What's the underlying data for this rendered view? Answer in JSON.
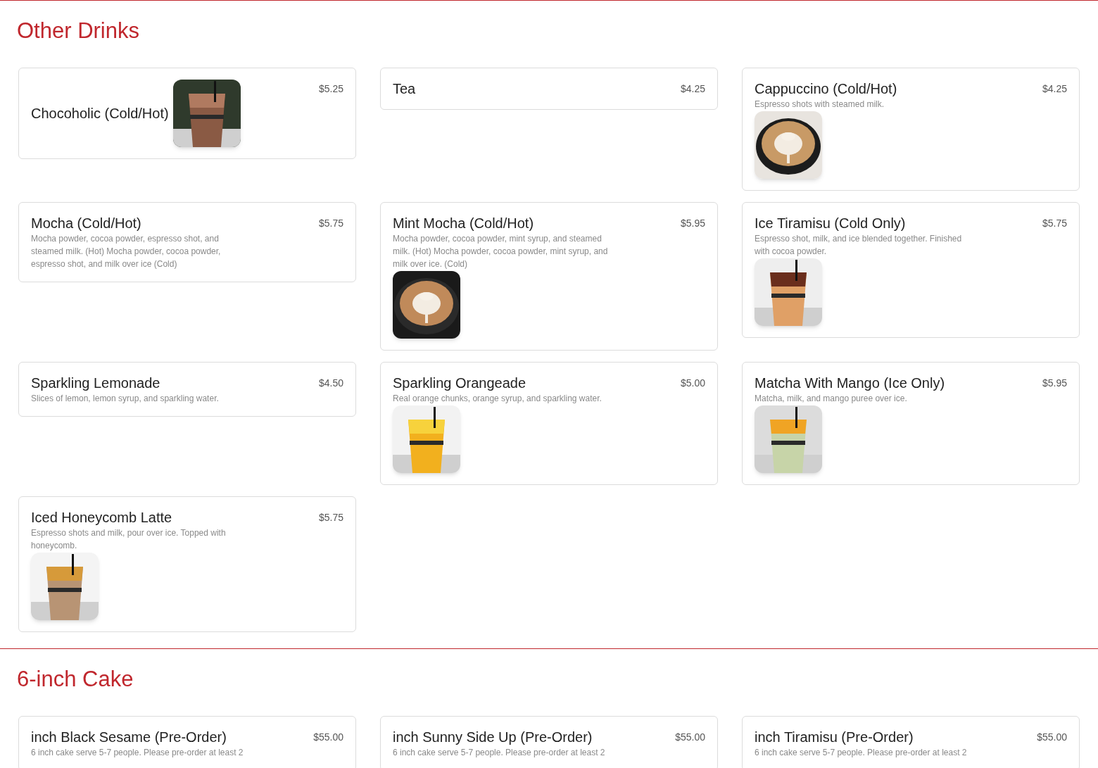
{
  "sections": [
    {
      "title": "Other Drinks",
      "items": [
        {
          "name": "Chocoholic (Cold/Hot)",
          "price": "$5.25",
          "kind": "inline"
        },
        {
          "name": "Tea",
          "price": "$4.25"
        },
        {
          "name": "Cappuccino (Cold/Hot)",
          "price": "$4.25",
          "description": "Espresso shots with steamed milk."
        },
        {
          "name": "Mocha (Cold/Hot)",
          "price": "$5.75",
          "description": "Mocha powder, cocoa powder, espresso shot, and steamed milk. (Hot) Mocha powder, cocoa powder, espresso shot, and milk over ice (Cold)"
        },
        {
          "name": "Mint Mocha (Cold/Hot)",
          "price": "$5.95",
          "description": "Mocha powder, cocoa powder, mint syrup, and steamed milk. (Hot) Mocha powder, cocoa powder, mint syrup, and milk over ice. (Cold)"
        },
        {
          "name": "Ice Tiramisu (Cold Only)",
          "price": "$5.75",
          "description": "Espresso shot, milk, and ice blended together. Finished with cocoa powder."
        },
        {
          "name": "Sparkling Lemonade",
          "price": "$4.50",
          "description": "Slices of lemon, lemon syrup, and sparkling water."
        },
        {
          "name": "Sparkling Orangeade",
          "price": "$5.00",
          "description": "Real orange chunks, orange syrup, and sparkling water."
        },
        {
          "name": "Matcha With Mango (Ice Only)",
          "price": "$5.95",
          "description": "Matcha, milk, and mango puree over ice."
        },
        {
          "name": "Iced Honeycomb Latte",
          "price": "$5.75",
          "description": "Espresso shots and milk, pour over ice. Topped with honeycomb."
        }
      ]
    },
    {
      "title": "6-inch Cake",
      "items": [
        {
          "name": "inch Black Sesame (Pre-Order)",
          "price": "$55.00",
          "description": "6 inch cake serve 5-7 people. Please pre-order at least 2"
        },
        {
          "name": "inch Sunny Side Up (Pre-Order)",
          "price": "$55.00",
          "description": "6 inch cake serve 5-7 people. Please pre-order at least 2"
        },
        {
          "name": "inch Tiramisu (Pre-Order)",
          "price": "$55.00",
          "description": "6 inch cake serve 5-7 people. Please pre-order at least 2"
        }
      ]
    }
  ]
}
